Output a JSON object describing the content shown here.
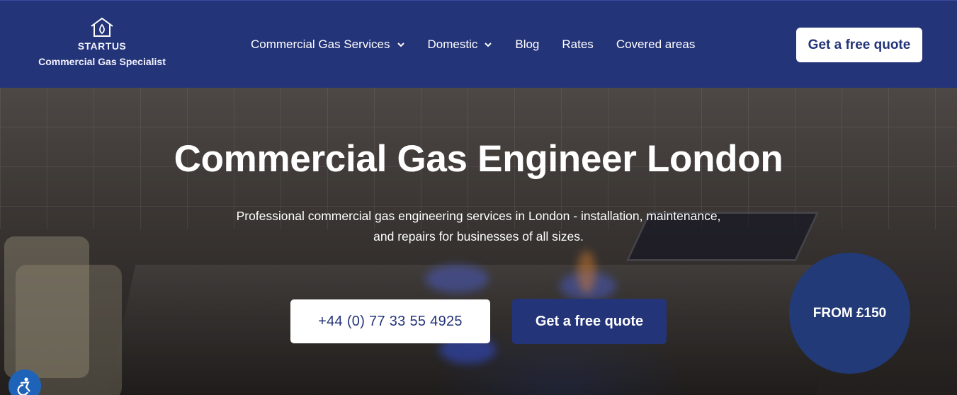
{
  "header": {
    "logo": {
      "icon": "house-flame-icon",
      "brand": "STARTUS",
      "tagline": "Commercial Gas Specialist"
    },
    "nav": [
      {
        "label": "Commercial Gas Services",
        "dropdown": true
      },
      {
        "label": "Domestic",
        "dropdown": true
      },
      {
        "label": "Blog",
        "dropdown": false
      },
      {
        "label": "Rates",
        "dropdown": false
      },
      {
        "label": "Covered areas",
        "dropdown": false
      }
    ],
    "cta_label": "Get a free quote"
  },
  "hero": {
    "title": "Commercial Gas Engineer London",
    "subtitle_line1": "Professional commercial gas engineering services in London - installation, maintenance,",
    "subtitle_line2": "and repairs for businesses of all sizes.",
    "phone_button": "+44 (0) 77 33 55 4925",
    "quote_button": "Get a free quote",
    "price_badge": "FROM £150",
    "accessibility_icon": "accessibility-icon"
  },
  "colors": {
    "brand_navy": "#243479",
    "badge": "#223a78",
    "accessibility": "#1e63b8",
    "white": "#ffffff"
  }
}
